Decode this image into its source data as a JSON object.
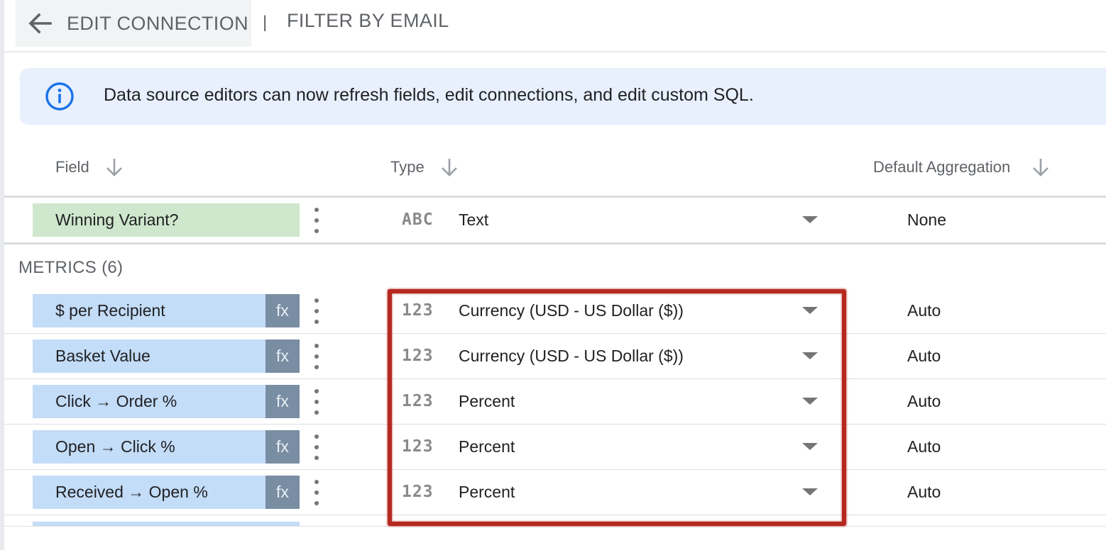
{
  "toolbar": {
    "back_label": "EDIT CONNECTION",
    "separator": "|",
    "filter_label": "FILTER BY EMAIL"
  },
  "banner": {
    "text": "Data source editors can now refresh fields, edit connections, and edit custom SQL."
  },
  "columns": {
    "field": "Field",
    "type": "Type",
    "aggregation": "Default Aggregation"
  },
  "dimension_row": {
    "name": "Winning Variant?",
    "type_icon": "ABC",
    "type": "Text",
    "aggregation": "None"
  },
  "metrics": {
    "section_label": "METRICS (6)",
    "fx_label": "fx",
    "rows": [
      {
        "name": "$ per Recipient",
        "type_icon": "123",
        "type": "Currency (USD - US Dollar ($))",
        "aggregation": "Auto"
      },
      {
        "name": "Basket Value",
        "type_icon": "123",
        "type": "Currency (USD - US Dollar ($))",
        "aggregation": "Auto"
      },
      {
        "name": "Click → Order %",
        "type_icon": "123",
        "type": "Percent",
        "aggregation": "Auto"
      },
      {
        "name": "Open → Click %",
        "type_icon": "123",
        "type": "Percent",
        "aggregation": "Auto"
      },
      {
        "name": "Received → Open %",
        "type_icon": "123",
        "type": "Percent",
        "aggregation": "Auto"
      }
    ]
  },
  "colors": {
    "dimension_chip": "#cfe7cc",
    "metric_chip": "#c3dcf7",
    "fx_badge": "#7a8ea3",
    "banner_bg": "#e8f0fe",
    "info_icon": "#1a73e8",
    "highlight_box": "#b5281f"
  },
  "icons": {
    "back": "arrow-left-icon",
    "info": "info-circle-icon",
    "sort": "arrow-down-icon",
    "menu": "more-vert-icon",
    "dropdown": "caret-down-icon"
  }
}
